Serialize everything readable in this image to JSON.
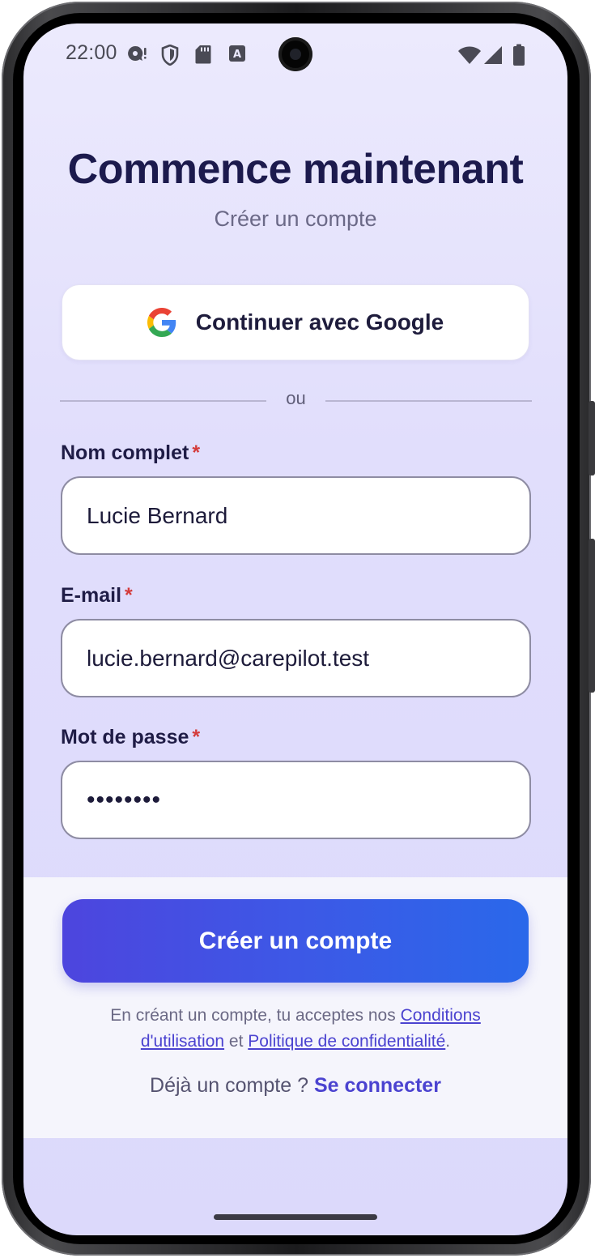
{
  "status_bar": {
    "time": "22:00",
    "left_icons": [
      "chat-bubble-icon",
      "shield-icon",
      "sd-card-icon",
      "text-recognition-icon"
    ],
    "right_icons": [
      "wifi-icon",
      "cell-signal-icon",
      "battery-icon"
    ]
  },
  "header": {
    "title": "Commence maintenant",
    "subtitle": "Créer un compte"
  },
  "google_button": {
    "label": "Continuer avec Google",
    "icon": "google-logo-icon"
  },
  "divider": {
    "text": "ou"
  },
  "form": {
    "full_name": {
      "label": "Nom complet",
      "required_mark": "*",
      "value": "Lucie Bernard"
    },
    "email": {
      "label": "E-mail",
      "required_mark": "*",
      "value": "lucie.bernard@carepilot.test"
    },
    "password": {
      "label": "Mot de passe",
      "required_mark": "*",
      "value": "••••••••"
    }
  },
  "actions": {
    "create_label": "Créer un compte"
  },
  "legal": {
    "prefix": "En créant un compte, tu acceptes nos ",
    "terms_link": "Conditions d'utilisation",
    "conjunction": " et ",
    "privacy_link": "Politique de confidentialité",
    "suffix": "."
  },
  "login": {
    "prompt": "Déjà un compte ? ",
    "link": "Se connecter"
  },
  "colors": {
    "accent": "#4b43d0",
    "title": "#1c1a4d",
    "required": "#d43b3b"
  }
}
